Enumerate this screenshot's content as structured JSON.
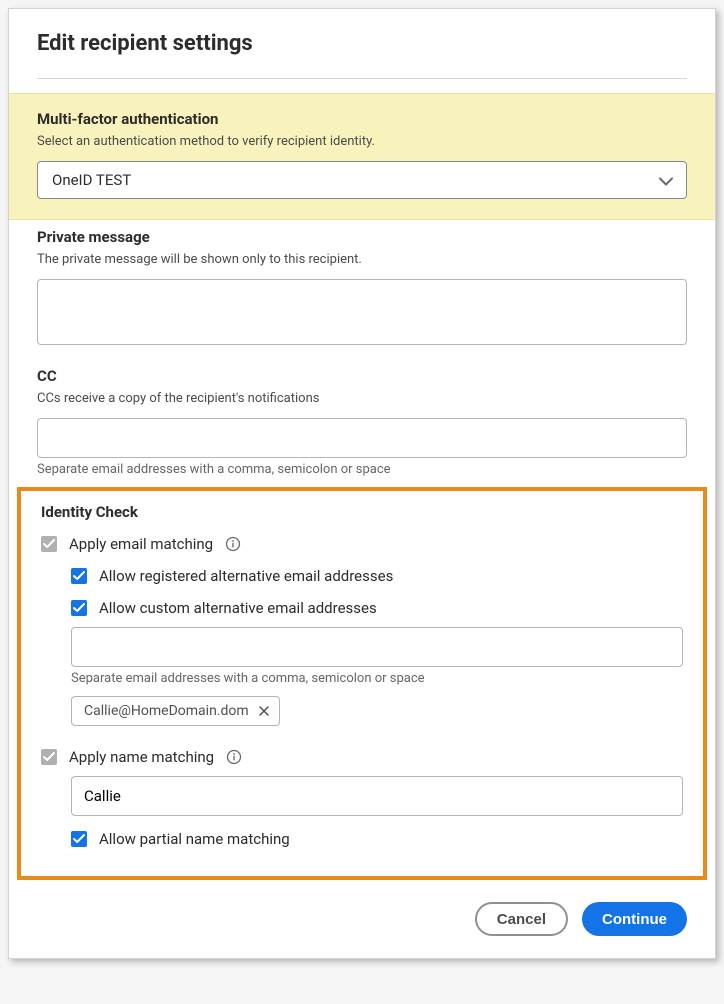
{
  "dialog": {
    "title": "Edit recipient settings"
  },
  "mfa": {
    "title": "Multi-factor authentication",
    "desc": "Select an authentication method to verify recipient identity.",
    "selected": "OneID TEST"
  },
  "privateMessage": {
    "title": "Private message",
    "desc": "The private message will be shown only to this recipient.",
    "value": ""
  },
  "cc": {
    "title": "CC",
    "desc": "CCs receive a copy of the recipient's notifications",
    "value": "",
    "helper": "Separate email addresses with a comma, semicolon or space"
  },
  "identity": {
    "title": "Identity Check",
    "applyEmail": {
      "label": "Apply email matching",
      "checked": true
    },
    "allowRegistered": {
      "label": "Allow registered alternative email addresses",
      "checked": true
    },
    "allowCustom": {
      "label": "Allow custom alternative email addresses",
      "checked": true,
      "inputValue": "",
      "helper": "Separate email addresses with a comma, semicolon or space",
      "chips": [
        "Callie@HomeDomain.dom"
      ]
    },
    "applyName": {
      "label": "Apply name matching",
      "checked": true,
      "value": "Callie"
    },
    "allowPartial": {
      "label": "Allow partial name matching",
      "checked": true
    }
  },
  "footer": {
    "cancel": "Cancel",
    "continue": "Continue"
  }
}
